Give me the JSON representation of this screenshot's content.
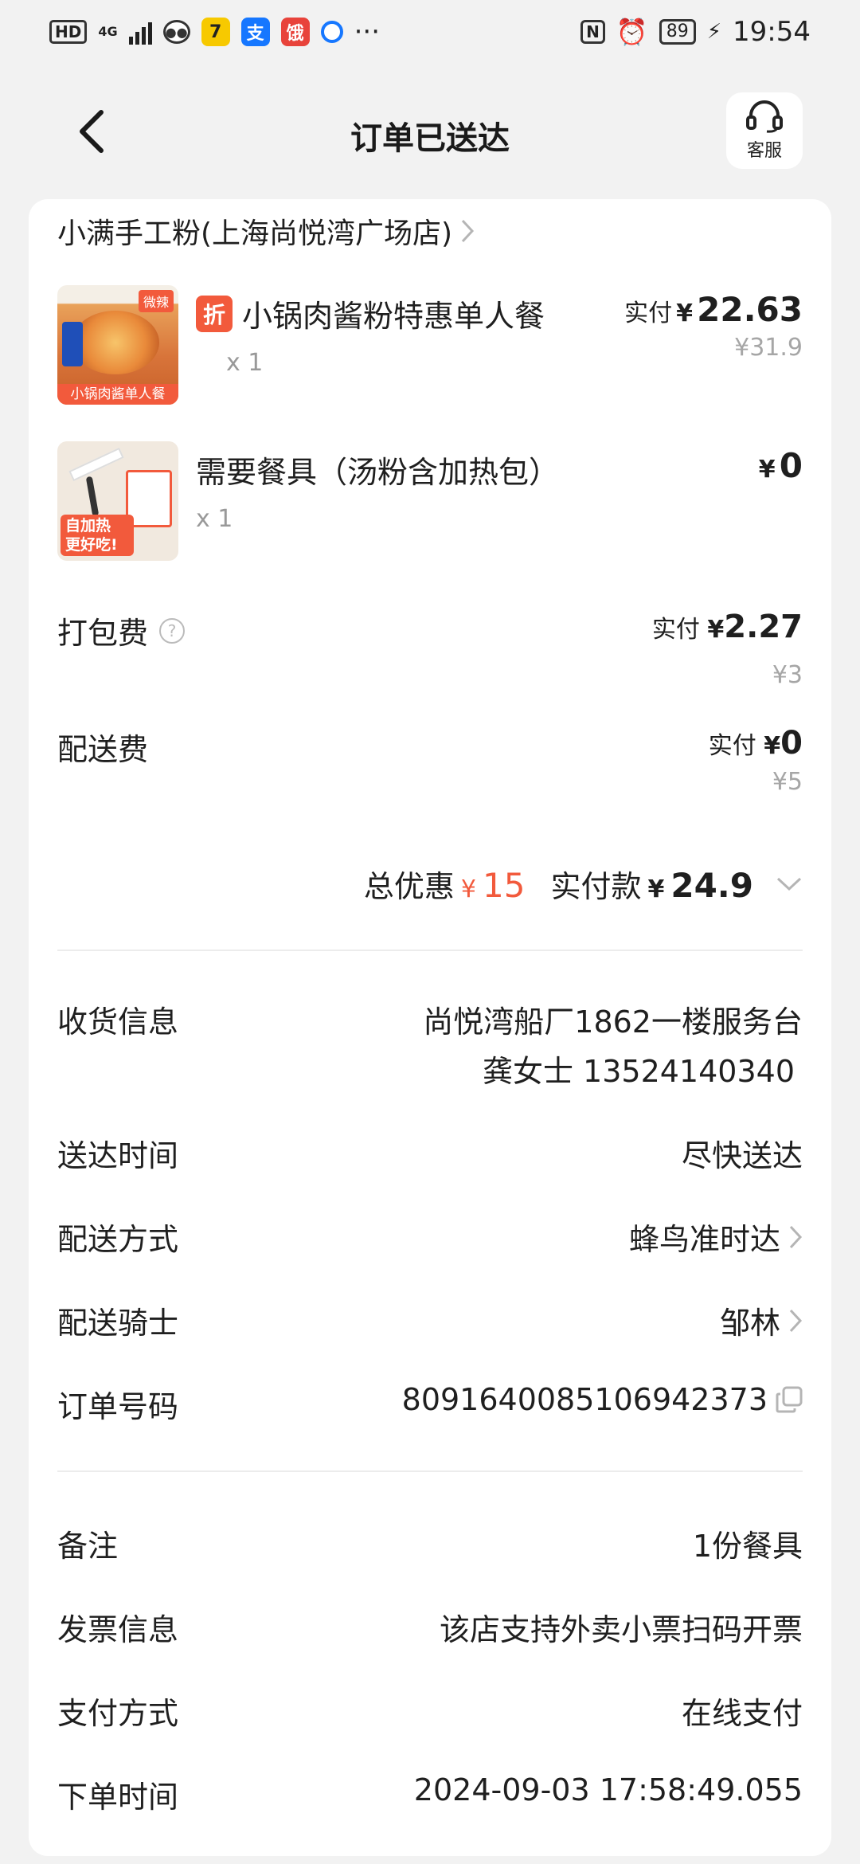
{
  "status_bar": {
    "hd": "HD",
    "network": "4G",
    "time": "19:54",
    "battery": "89",
    "more": "···"
  },
  "header": {
    "title": "订单已送达",
    "customer_service": "客服"
  },
  "shop": {
    "name": "小满手工粉(上海尚悦湾广场店)"
  },
  "items": [
    {
      "badge": "折",
      "name": "小锅肉酱粉特惠单人餐",
      "qty": "x 1",
      "paid_label": "实付",
      "currency": "¥",
      "paid": "22.63",
      "original": "¥31.9",
      "thumb_tag": "微辣",
      "thumb_caption": "小锅肉酱单人餐"
    },
    {
      "name": "需要餐具（汤粉含加热包）",
      "qty": "x 1",
      "currency": "¥",
      "paid": "0",
      "thumb_caption": "自加热 更好吃!"
    }
  ],
  "fees": [
    {
      "label": "打包费",
      "paid_label": "实付",
      "currency": "¥",
      "paid": "2.27",
      "original": "¥3"
    },
    {
      "label": "配送费",
      "paid_label": "实付",
      "currency": "¥",
      "paid": "0",
      "original": "¥5"
    }
  ],
  "totals": {
    "discount_label": "总优惠",
    "currency": "¥",
    "discount": "15",
    "paid_label": "实付款",
    "paid": "24.9"
  },
  "delivery_info": {
    "address_label": "收货信息",
    "address_line1": "尚悦湾船厂1862一楼服务台",
    "address_line2": "龚女士 13524140340",
    "time_label": "送达时间",
    "time_value": "尽快送达",
    "method_label": "配送方式",
    "method_value": "蜂鸟准时达",
    "rider_label": "配送骑士",
    "rider_value": "邹林",
    "order_no_label": "订单号码",
    "order_no_value": "8091640085106942373"
  },
  "order_info": {
    "note_label": "备注",
    "note_value": "1份餐具",
    "invoice_label": "发票信息",
    "invoice_value": "该店支持外卖小票扫码开票",
    "payment_label": "支付方式",
    "payment_value": "在线支付",
    "order_time_label": "下单时间",
    "order_time_value": "2024-09-03 17:58:49.055"
  },
  "colors": {
    "accent_red": "#f25a3c",
    "background": "#f2f2f2",
    "card": "#ffffff"
  }
}
